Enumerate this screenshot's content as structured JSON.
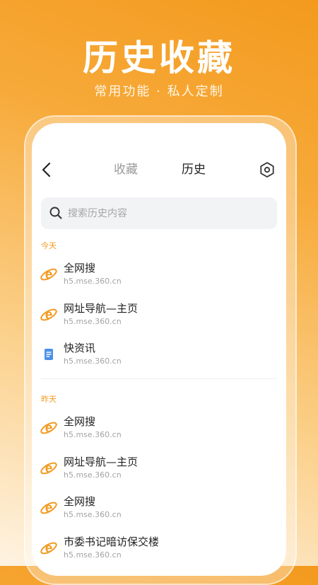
{
  "hero": {
    "title": "历史收藏",
    "subtitle": "常用功能 · 私人定制"
  },
  "topbar": {
    "tabs": [
      {
        "label": "收藏",
        "active": false
      },
      {
        "label": "历史",
        "active": true
      }
    ]
  },
  "search": {
    "placeholder": "搜索历史内容",
    "value": ""
  },
  "sections": [
    {
      "label": "今天",
      "items": [
        {
          "title": "全网搜",
          "url": "h5.mse.360.cn",
          "icon": "browser-e-icon"
        },
        {
          "title": "网址导航—主页",
          "url": "h5.mse.360.cn",
          "icon": "browser-e-icon"
        },
        {
          "title": "快资讯",
          "url": "h5.mse.360.cn",
          "icon": "news-doc-icon"
        }
      ]
    },
    {
      "label": "昨天",
      "items": [
        {
          "title": "全网搜",
          "url": "h5.mse.360.cn",
          "icon": "browser-e-icon"
        },
        {
          "title": "网址导航—主页",
          "url": "h5.mse.360.cn",
          "icon": "browser-e-icon"
        },
        {
          "title": "全网搜",
          "url": "h5.mse.360.cn",
          "icon": "browser-e-icon"
        },
        {
          "title": "市委书记暗访保交楼",
          "url": "h5.mse.360.cn",
          "icon": "browser-e-icon"
        }
      ]
    }
  ],
  "colors": {
    "accent": "#f39a1e",
    "news_icon": "#4b8fe8"
  }
}
